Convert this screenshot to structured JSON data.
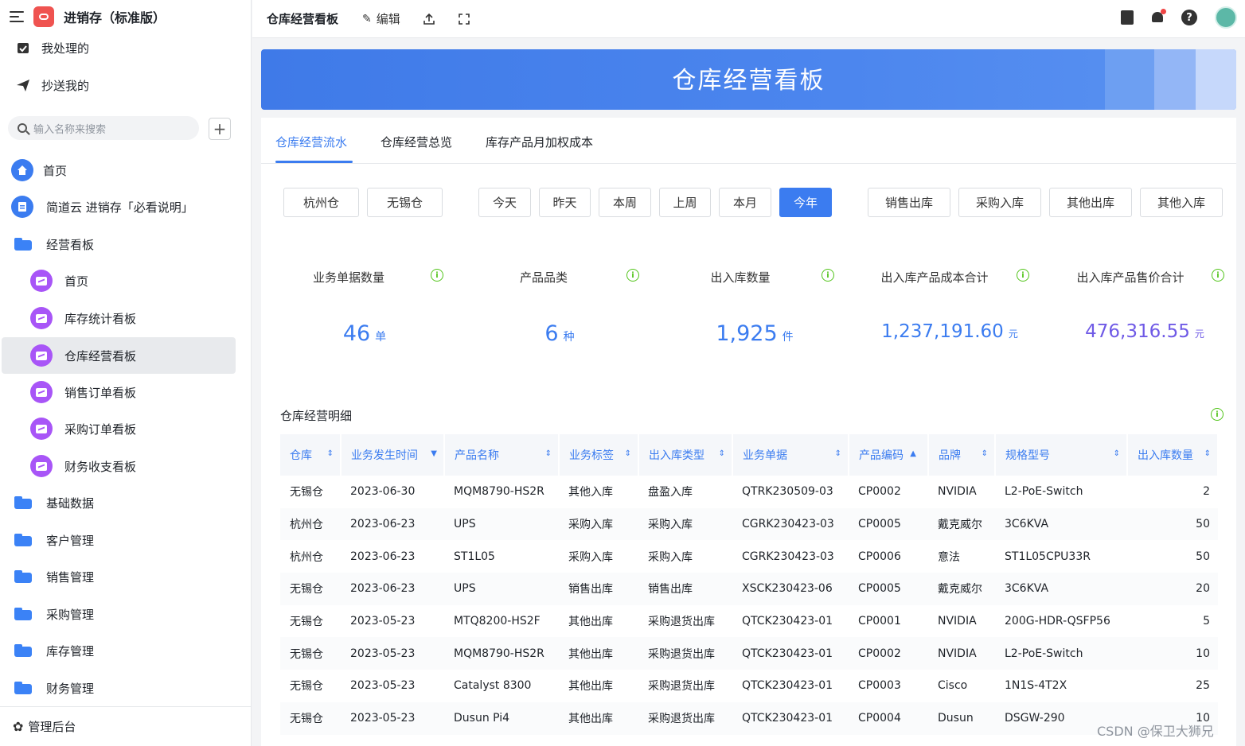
{
  "app": {
    "name": "进销存（标准版）"
  },
  "sidebar": {
    "top_items": [
      {
        "label": "我处理的",
        "icon": "check-calendar-icon"
      },
      {
        "label": "抄送我的",
        "icon": "send-icon"
      }
    ],
    "search_placeholder": "输入名称来搜索",
    "items": [
      {
        "label": "首页",
        "icon": "home-icon"
      },
      {
        "label": "简道云 进销存「必看说明」",
        "icon": "document-icon"
      },
      {
        "label": "经营看板",
        "icon": "folder-icon"
      },
      {
        "label": "首页",
        "icon": "dashboard-icon"
      },
      {
        "label": "库存统计看板",
        "icon": "dashboard-icon"
      },
      {
        "label": "仓库经营看板",
        "icon": "dashboard-icon",
        "active": true
      },
      {
        "label": "销售订单看板",
        "icon": "dashboard-icon"
      },
      {
        "label": "采购订单看板",
        "icon": "dashboard-icon"
      },
      {
        "label": "财务收支看板",
        "icon": "dashboard-icon"
      },
      {
        "label": "基础数据",
        "icon": "folder-icon"
      },
      {
        "label": "客户管理",
        "icon": "folder-icon"
      },
      {
        "label": "销售管理",
        "icon": "folder-icon"
      },
      {
        "label": "采购管理",
        "icon": "folder-icon"
      },
      {
        "label": "库存管理",
        "icon": "folder-icon"
      },
      {
        "label": "财务管理",
        "icon": "folder-icon"
      }
    ],
    "footer": "管理后台"
  },
  "topbar": {
    "title": "仓库经营看板",
    "edit": "编辑"
  },
  "banner": {
    "title": "仓库经营看板"
  },
  "tabs": [
    "仓库经营流水",
    "仓库经营总览",
    "库存产品月加权成本"
  ],
  "filters": {
    "warehouses": [
      "杭州仓",
      "无锡仓"
    ],
    "periods": [
      "今天",
      "昨天",
      "本周",
      "上周",
      "本月",
      "今年"
    ],
    "active_period": "今年",
    "types": [
      "销售出库",
      "采购入库",
      "其他出库",
      "其他入库"
    ]
  },
  "kpis": [
    {
      "label": "业务单据数量",
      "value": "46",
      "unit": "单",
      "color": "#3b7cf0"
    },
    {
      "label": "产品品类",
      "value": "6",
      "unit": "种",
      "color": "#3b7cf0"
    },
    {
      "label": "出入库数量",
      "value": "1,925",
      "unit": "件",
      "color": "#3b7cf0"
    },
    {
      "label": "出入库产品成本合计",
      "value": "1,237,191.60",
      "unit": "元",
      "color": "#3b7cf0"
    },
    {
      "label": "出入库产品售价合计",
      "value": "476,316.55",
      "unit": "元",
      "color": "#6f5ae6"
    }
  ],
  "detail": {
    "title": "仓库经营明细",
    "columns": [
      "仓库",
      "业务发生时间",
      "产品名称",
      "业务标签",
      "出入库类型",
      "业务单据",
      "产品编码",
      "品牌",
      "规格型号",
      "出入库数量"
    ],
    "rows": [
      [
        "无锡仓",
        "2023-06-30",
        "MQM8790-HS2R",
        "其他入库",
        "盘盈入库",
        "QTRK230509-03",
        "CP0002",
        "NVIDIA",
        "L2-PoE-Switch",
        "2"
      ],
      [
        "杭州仓",
        "2023-06-23",
        "UPS",
        "采购入库",
        "采购入库",
        "CGRK230423-03",
        "CP0005",
        "戴克威尔",
        "3C6KVA",
        "50"
      ],
      [
        "杭州仓",
        "2023-06-23",
        "ST1L05",
        "采购入库",
        "采购入库",
        "CGRK230423-03",
        "CP0006",
        "意法",
        "ST1L05CPU33R",
        "50"
      ],
      [
        "无锡仓",
        "2023-06-23",
        "UPS",
        "销售出库",
        "销售出库",
        "XSCK230423-06",
        "CP0005",
        "戴克威尔",
        "3C6KVA",
        "20"
      ],
      [
        "无锡仓",
        "2023-05-23",
        "MTQ8200-HS2F",
        "其他出库",
        "采购退货出库",
        "QTCK230423-01",
        "CP0001",
        "NVIDIA",
        "200G-HDR-QSFP56",
        "5"
      ],
      [
        "无锡仓",
        "2023-05-23",
        "MQM8790-HS2R",
        "其他出库",
        "采购退货出库",
        "QTCK230423-01",
        "CP0002",
        "NVIDIA",
        "L2-PoE-Switch",
        "10"
      ],
      [
        "无锡仓",
        "2023-05-23",
        "Catalyst 8300",
        "其他出库",
        "采购退货出库",
        "QTCK230423-01",
        "CP0003",
        "Cisco",
        "1N1S-4T2X",
        "25"
      ],
      [
        "无锡仓",
        "2023-05-23",
        "Dusun Pi4",
        "其他出库",
        "采购退货出库",
        "QTCK230423-01",
        "CP0004",
        "Dusun",
        "DSGW-290",
        "10"
      ]
    ]
  },
  "watermark": "CSDN @保卫大狮兄"
}
